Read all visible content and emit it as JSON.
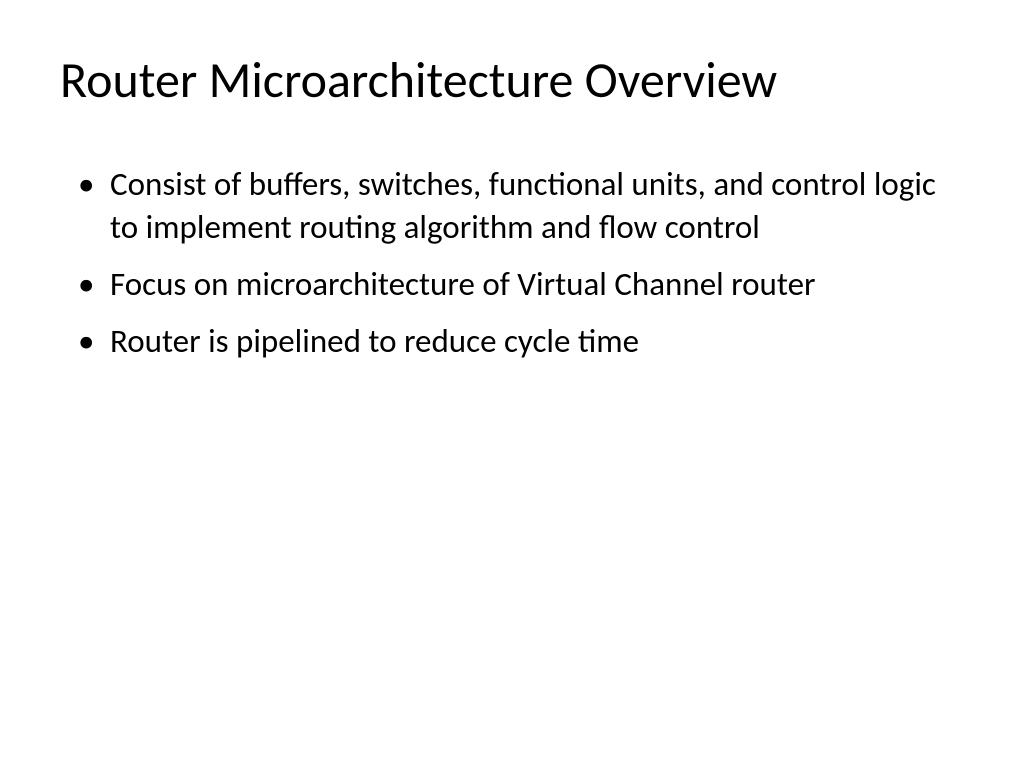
{
  "slide": {
    "title": "Router Microarchitecture Overview",
    "bullets": [
      "Consist of buffers, switches, functional units, and control logic to implement routing algorithm and flow control",
      "Focus on microarchitecture of Virtual Channel router",
      "Router is pipelined to reduce cycle time"
    ]
  }
}
